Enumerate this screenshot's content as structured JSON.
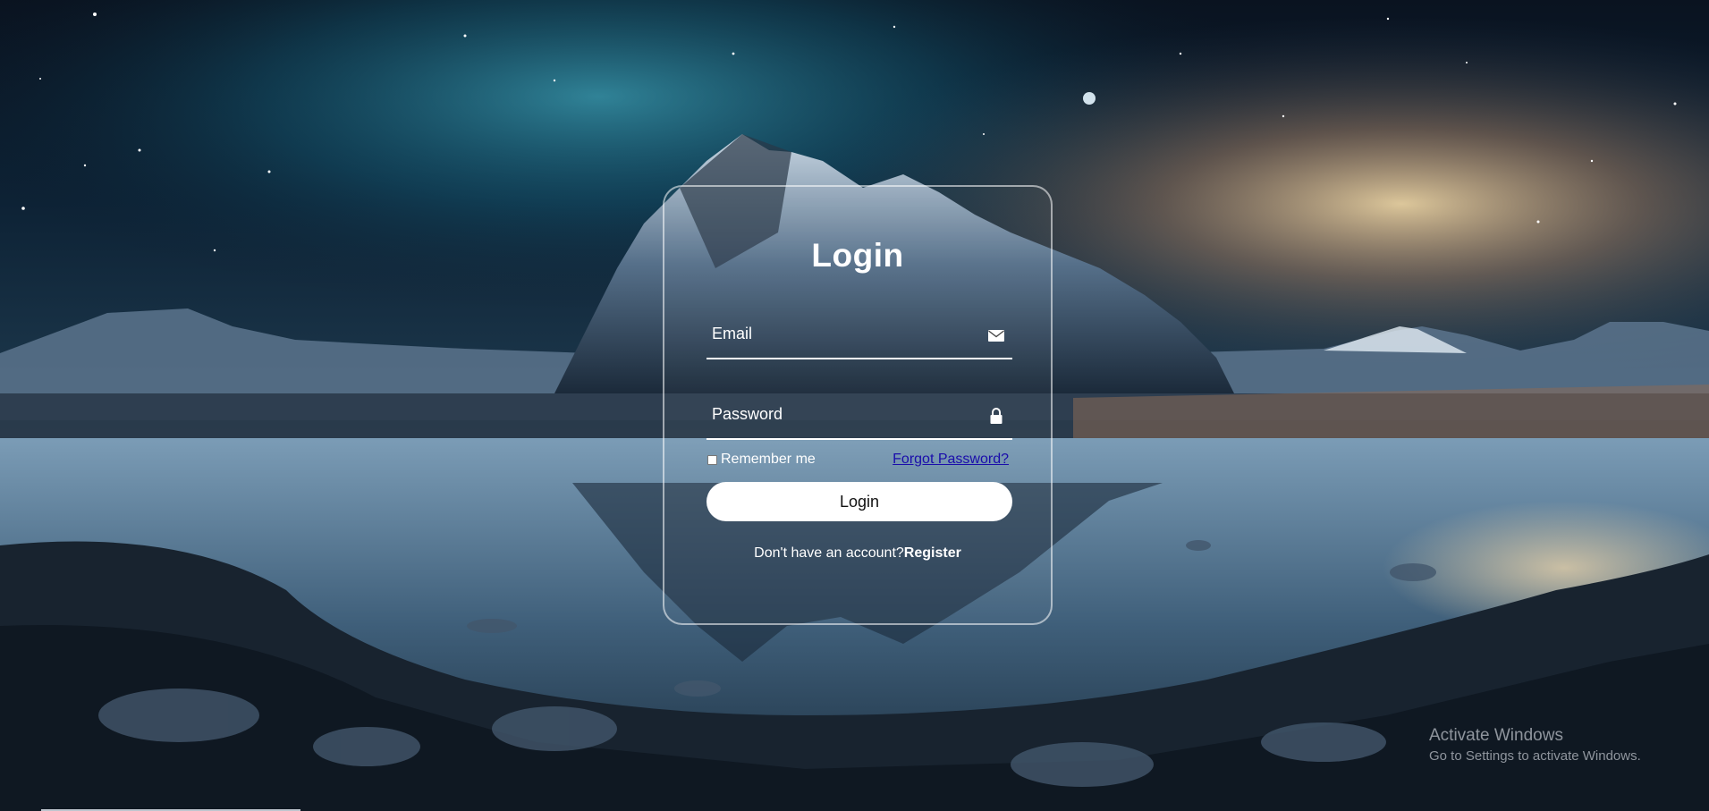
{
  "login": {
    "title": "Login",
    "email_placeholder": "Email",
    "password_placeholder": "Password",
    "remember_label": "Remember me",
    "forgot_label": "Forgot Password?",
    "button_label": "Login",
    "register_prompt": "Don't have an account?",
    "register_link": "Register",
    "icons": {
      "email": "envelope-icon",
      "password": "lock-icon"
    }
  },
  "watermark": {
    "line1": "Activate Windows",
    "line2": "Go to Settings to activate Windows."
  },
  "colors": {
    "link": "#1a0dab",
    "button": "#ffffff",
    "text": "#ffffff"
  }
}
